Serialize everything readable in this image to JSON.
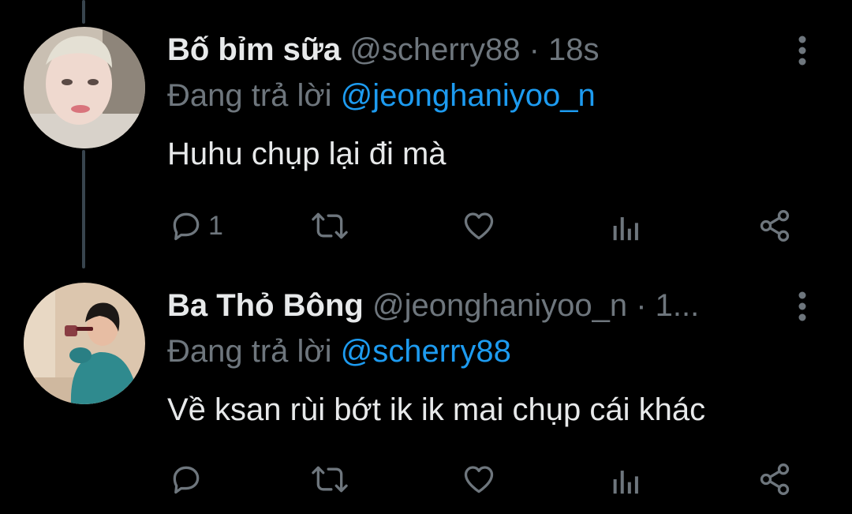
{
  "thread": {
    "tweets": [
      {
        "display_name": "Bố bỉm sữa",
        "handle": "@scherry88",
        "time": "· 18s",
        "replying_prefix": "Đang trả lời",
        "replying_to": "@jeonghaniyoo_n",
        "text": "Huhu chụp lại đi mà",
        "reply_count": "1",
        "icons": {
          "reply": "reply-icon",
          "retweet": "retweet-icon",
          "like": "heart-icon",
          "views": "views-icon",
          "share": "share-icon",
          "more": "more-options-icon"
        }
      },
      {
        "display_name": "Ba Thỏ Bông",
        "handle": "@jeonghaniyoo_n",
        "time": "· 1...",
        "replying_prefix": "Đang trả lời",
        "replying_to": "@scherry88",
        "text": "Về ksan rùi bớt ik ik mai chụp cái khác",
        "reply_count": "",
        "icons": {
          "reply": "reply-icon",
          "retweet": "retweet-icon",
          "like": "heart-icon",
          "views": "views-icon",
          "share": "share-icon",
          "more": "more-options-icon"
        }
      }
    ]
  },
  "colors": {
    "background": "#000000",
    "text_primary": "#e7e9ea",
    "text_secondary": "#6e767d",
    "link": "#1d9bf0",
    "thread_line": "#38444d"
  }
}
